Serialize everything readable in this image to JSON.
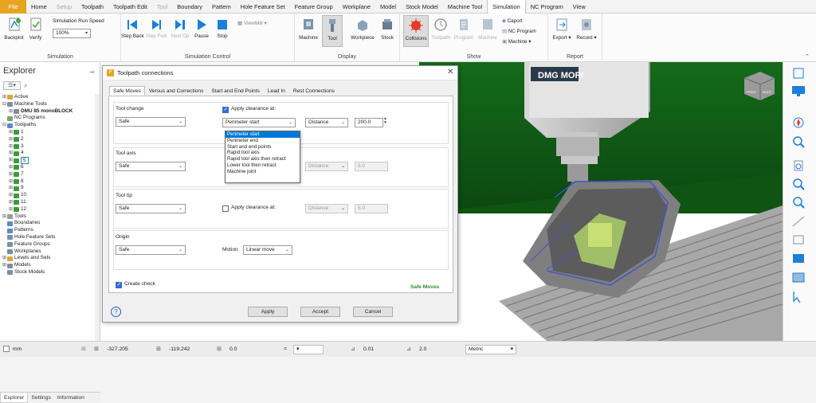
{
  "menu_tabs": [
    {
      "label": "File",
      "state": "file"
    },
    {
      "label": "Home",
      "state": "normal"
    },
    {
      "label": "Setup",
      "state": "disabled"
    },
    {
      "label": "Toolpath",
      "state": "normal"
    },
    {
      "label": "Toolpath Edit",
      "state": "normal"
    },
    {
      "label": "Tool",
      "state": "disabled"
    },
    {
      "label": "Boundary",
      "state": "normal"
    },
    {
      "label": "Pattern",
      "state": "normal"
    },
    {
      "label": "Hole Feature Set",
      "state": "normal"
    },
    {
      "label": "Feature Group",
      "state": "normal"
    },
    {
      "label": "Workplane",
      "state": "normal"
    },
    {
      "label": "Model",
      "state": "normal"
    },
    {
      "label": "Stock Model",
      "state": "normal"
    },
    {
      "label": "Machine Tool",
      "state": "normal"
    },
    {
      "label": "Simulation",
      "state": "active"
    },
    {
      "label": "NC Program",
      "state": "normal"
    },
    {
      "label": "View",
      "state": "normal"
    }
  ],
  "ribbon": {
    "simulation_group": {
      "label": "Simulation",
      "backplot": "Backplot",
      "verify": "Verify",
      "run_speed_label": "Simulation Run Speed",
      "run_speed_value": "100%"
    },
    "control_group": {
      "label": "Simulation Control",
      "step_back": "Step Back",
      "step_fwd": "Step Fwd",
      "next_op": "Next Op",
      "pause": "Pause",
      "stop": "Stop",
      "viewmill": "ViewMill"
    },
    "display_group": {
      "label": "Display",
      "machine": "Machine",
      "tool": "Tool",
      "workpiece": "Workpiece",
      "stock": "Stock"
    },
    "show_group": {
      "label": "Show",
      "collisions": "Collisions",
      "toolpath": "Toolpath",
      "program": "Program",
      "machine": "Machine",
      "caport": "Caport",
      "nc_program": "NC Program",
      "machine_small": "Machine"
    },
    "report_group": {
      "label": "Report",
      "export": "Export",
      "record": "Record"
    }
  },
  "explorer": {
    "title": "Explorer",
    "tree": [
      {
        "label": "Active",
        "indent": 0,
        "exp": "+",
        "color": "#d8a93a"
      },
      {
        "label": "Machine Tools",
        "indent": 0,
        "exp": "-",
        "color": "#7a8fa3"
      },
      {
        "label": "DMU 85 monoBLOCK",
        "indent": 1,
        "exp": "+",
        "color": "#7a8fa3",
        "bold": true
      },
      {
        "label": "NC Programs",
        "indent": 0,
        "exp": "",
        "color": "#7aa36b"
      },
      {
        "label": "Toolpaths",
        "indent": 0,
        "exp": "-",
        "color": "#5a8ac8"
      },
      {
        "label": "1",
        "indent": 1,
        "exp": "+",
        "color": "#3c9a3c"
      },
      {
        "label": "2",
        "indent": 1,
        "exp": "+",
        "color": "#3c9a3c"
      },
      {
        "label": "3",
        "indent": 1,
        "exp": "+",
        "color": "#3c9a3c"
      },
      {
        "label": "4",
        "indent": 1,
        "exp": "+",
        "color": "#3c9a3c"
      },
      {
        "label": "5",
        "indent": 1,
        "exp": "+",
        "color": "#3c9a3c",
        "boxed": true
      },
      {
        "label": "6",
        "indent": 1,
        "exp": "+",
        "color": "#3c9a3c"
      },
      {
        "label": "7",
        "indent": 1,
        "exp": "+",
        "color": "#3c9a3c"
      },
      {
        "label": "8",
        "indent": 1,
        "exp": "+",
        "color": "#3c9a3c"
      },
      {
        "label": "9",
        "indent": 1,
        "exp": "+",
        "color": "#3c9a3c"
      },
      {
        "label": "10",
        "indent": 1,
        "exp": "+",
        "color": "#3c9a3c"
      },
      {
        "label": "11",
        "indent": 1,
        "exp": "+",
        "color": "#3c9a3c"
      },
      {
        "label": "12",
        "indent": 1,
        "exp": "+",
        "color": "#3c9a3c"
      },
      {
        "label": "Tools",
        "indent": 0,
        "exp": "+",
        "color": "#9a9a9a"
      },
      {
        "label": "Boundaries",
        "indent": 0,
        "exp": "",
        "color": "#5a8ac8"
      },
      {
        "label": "Patterns",
        "indent": 0,
        "exp": "",
        "color": "#5a8ac8"
      },
      {
        "label": "Hole Feature Sets",
        "indent": 0,
        "exp": "",
        "color": "#7a8fa3"
      },
      {
        "label": "Feature Groups",
        "indent": 0,
        "exp": "",
        "color": "#7a8fa3"
      },
      {
        "label": "Workplanes",
        "indent": 0,
        "exp": "",
        "color": "#7a8fa3"
      },
      {
        "label": "Levels and Sets",
        "indent": 0,
        "exp": "+",
        "color": "#d8a93a"
      },
      {
        "label": "Models",
        "indent": 0,
        "exp": "+",
        "color": "#7a8fa3"
      },
      {
        "label": "Stock Models",
        "indent": 0,
        "exp": "",
        "color": "#7a8fa3"
      }
    ],
    "bottom_tabs": [
      "Explorer",
      "Settings",
      "Information"
    ]
  },
  "viewport": {
    "machine_brand": "DMG MORI",
    "cube_labels": [
      "FRONT",
      "RIGHT"
    ]
  },
  "dialog": {
    "title": "Toolpath connections",
    "tabs": [
      "Safe Moves",
      "Versus and Corrections",
      "Start and End Points",
      "Lead In",
      "Rest Connections"
    ],
    "tool_change": {
      "label": "Tool change",
      "value": "Safe",
      "apply_label": "Apply clearance at:",
      "apply_checked": true,
      "clearance_value": "Perimeter start",
      "measure_value": "Distance",
      "amount": "200.0"
    },
    "dropdown_options": [
      "Perimeter start",
      "Perimeter end",
      "Start and end points",
      "Rapid tool axis",
      "Rapid tool axis then retract",
      "Lower tool then retract",
      "Machine joint"
    ],
    "tool_axis": {
      "label": "Tool axis",
      "value": "Safe",
      "measure_value": "Distance",
      "amount": "5.0"
    },
    "tool_tip": {
      "label": "Tool tip",
      "value": "Safe",
      "apply_label": "Apply clearance at:",
      "measure_value": "Distance",
      "amount": "5.0"
    },
    "origin": {
      "label": "Origin",
      "value": "Safe",
      "motion_label": "Motion",
      "motion_value": "Linear move"
    },
    "create_check": "Create check",
    "footer_text": "Safe Moves",
    "apply_btn": "Apply",
    "accept_btn": "Accept",
    "cancel_btn": "Cancel",
    "help": "?"
  },
  "status": {
    "units": "mm",
    "x": "-327.205",
    "y": "-119.242",
    "z": "0.0",
    "tol": "0.01",
    "step": "2.0",
    "system": "Metric"
  }
}
